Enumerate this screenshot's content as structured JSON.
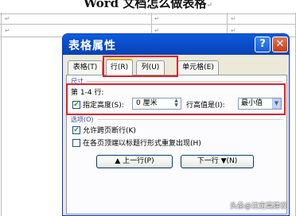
{
  "document": {
    "title": "Word 文档怎么做表格",
    "title_mark": "↵",
    "cell_mark": "↵"
  },
  "dialog": {
    "title": "表格属性",
    "help_glyph": "?",
    "close_glyph": "✕",
    "tabs": [
      {
        "label": "表格(T)",
        "selected": false
      },
      {
        "label": "行(R)",
        "selected": true
      },
      {
        "label": "列(U)",
        "selected": false
      },
      {
        "label": "单元格(E)",
        "selected": false
      }
    ],
    "size_group": {
      "label": "尺寸",
      "rows_label": "第 1-4 行:",
      "specify_height_label": "指定高度(S):",
      "specify_height_checked": true,
      "check_glyph": "✔",
      "height_value": "0 厘米",
      "spin_up": "▲",
      "spin_down": "▼",
      "row_height_is_label": "行高值是(I):",
      "row_height_mode": "最小值",
      "select_arrow": "▼"
    },
    "options_group": {
      "label": "选项(O)",
      "allow_break_label": "允许跨页断行(K)",
      "allow_break_checked": true,
      "repeat_header_label": "在各页顶端以标题行形式重复出现(H)",
      "repeat_header_checked": false
    },
    "buttons": {
      "prev_row": "▲ 上一行(P)",
      "next_row": "下一行 ▼(N)"
    }
  },
  "watermark": "头条@注定高建议",
  "colors": {
    "titlebar": "#0a4bc7",
    "highlight_box": "#e21e2a",
    "active_tab_accent": "#f1a62a",
    "dialog_background": "#ece9d8"
  }
}
